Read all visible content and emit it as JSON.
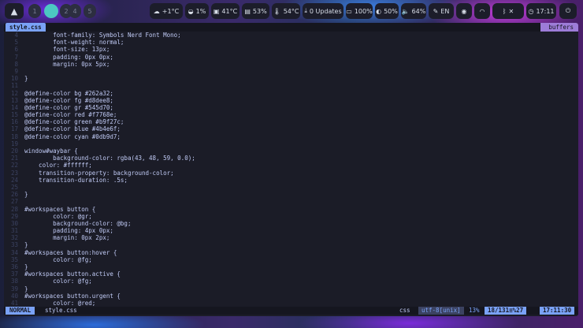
{
  "topbar": {
    "launcher_icon": "arch-logo",
    "workspaces": [
      "1",
      "2",
      "3",
      "4",
      "5"
    ],
    "weather": "+1°C",
    "cpu": "1%",
    "cpu_temp": "41°C",
    "memory": "53%",
    "gpu_temp": "54°C",
    "updates": "0 Updates",
    "battery": "100%",
    "brightness": "50%",
    "volume": "64%",
    "language": "EN",
    "clock": "17:11"
  },
  "editor": {
    "tab_label": "style.css",
    "buffers_label": "buffers",
    "lines": [
      {
        "n": "4",
        "t": "        font-family: Symbols Nerd Font Mono;"
      },
      {
        "n": "5",
        "t": "        font-weight: normal;"
      },
      {
        "n": "6",
        "t": "        font-size: 13px;"
      },
      {
        "n": "7",
        "t": "        padding: 0px 0px;"
      },
      {
        "n": "8",
        "t": "        margin: 0px 5px;"
      },
      {
        "n": "9",
        "t": ""
      },
      {
        "n": "10",
        "t": "}"
      },
      {
        "n": "11",
        "t": ""
      },
      {
        "n": "12",
        "t": "@define-color bg #262a32;"
      },
      {
        "n": "13",
        "t": "@define-color fg #d8dee8;"
      },
      {
        "n": "14",
        "t": "@define-color gr #545d70;"
      },
      {
        "n": "15",
        "t": "@define-color red #f7768e;"
      },
      {
        "n": "16",
        "t": "@define-color green #b9f27c;"
      },
      {
        "n": "17",
        "t": "@define-color blue #4b4e6f;"
      },
      {
        "n": "18",
        "t": "@define-color cyan #0db9d7;"
      },
      {
        "n": "19",
        "t": ""
      },
      {
        "n": "20",
        "t": "window#waybar {"
      },
      {
        "n": "21",
        "t": "        background-color: rgba(43, 48, 59, 0.0);"
      },
      {
        "n": "22",
        "t": "    color: #ffffff;"
      },
      {
        "n": "23",
        "t": "    transition-property: background-color;"
      },
      {
        "n": "24",
        "t": "    transition-duration: .5s;"
      },
      {
        "n": "25",
        "t": ""
      },
      {
        "n": "26",
        "t": "}"
      },
      {
        "n": "27",
        "t": ""
      },
      {
        "n": "28",
        "t": "#workspaces button {"
      },
      {
        "n": "29",
        "t": "        color: @gr;"
      },
      {
        "n": "30",
        "t": "        background-color: @bg;"
      },
      {
        "n": "31",
        "t": "        padding: 4px 0px;"
      },
      {
        "n": "32",
        "t": "        margin: 0px 2px;"
      },
      {
        "n": "33",
        "t": "}"
      },
      {
        "n": "34",
        "t": "#workspaces button:hover {"
      },
      {
        "n": "35",
        "t": "        color: @fg;"
      },
      {
        "n": "36",
        "t": "}"
      },
      {
        "n": "37",
        "t": "#workspaces button.active {"
      },
      {
        "n": "38",
        "t": "        color: @fg;"
      },
      {
        "n": "39",
        "t": "}"
      },
      {
        "n": "40",
        "t": "#workspaces button.urgent {"
      },
      {
        "n": "41",
        "t": "        color: @red;"
      }
    ]
  },
  "statusline": {
    "mode": "NORMAL",
    "file": "style.css",
    "filetype": "css",
    "encoding": "utf-8[unix]",
    "percent": "13%",
    "position": "18/131≡%27",
    "time": "17:11:30"
  }
}
